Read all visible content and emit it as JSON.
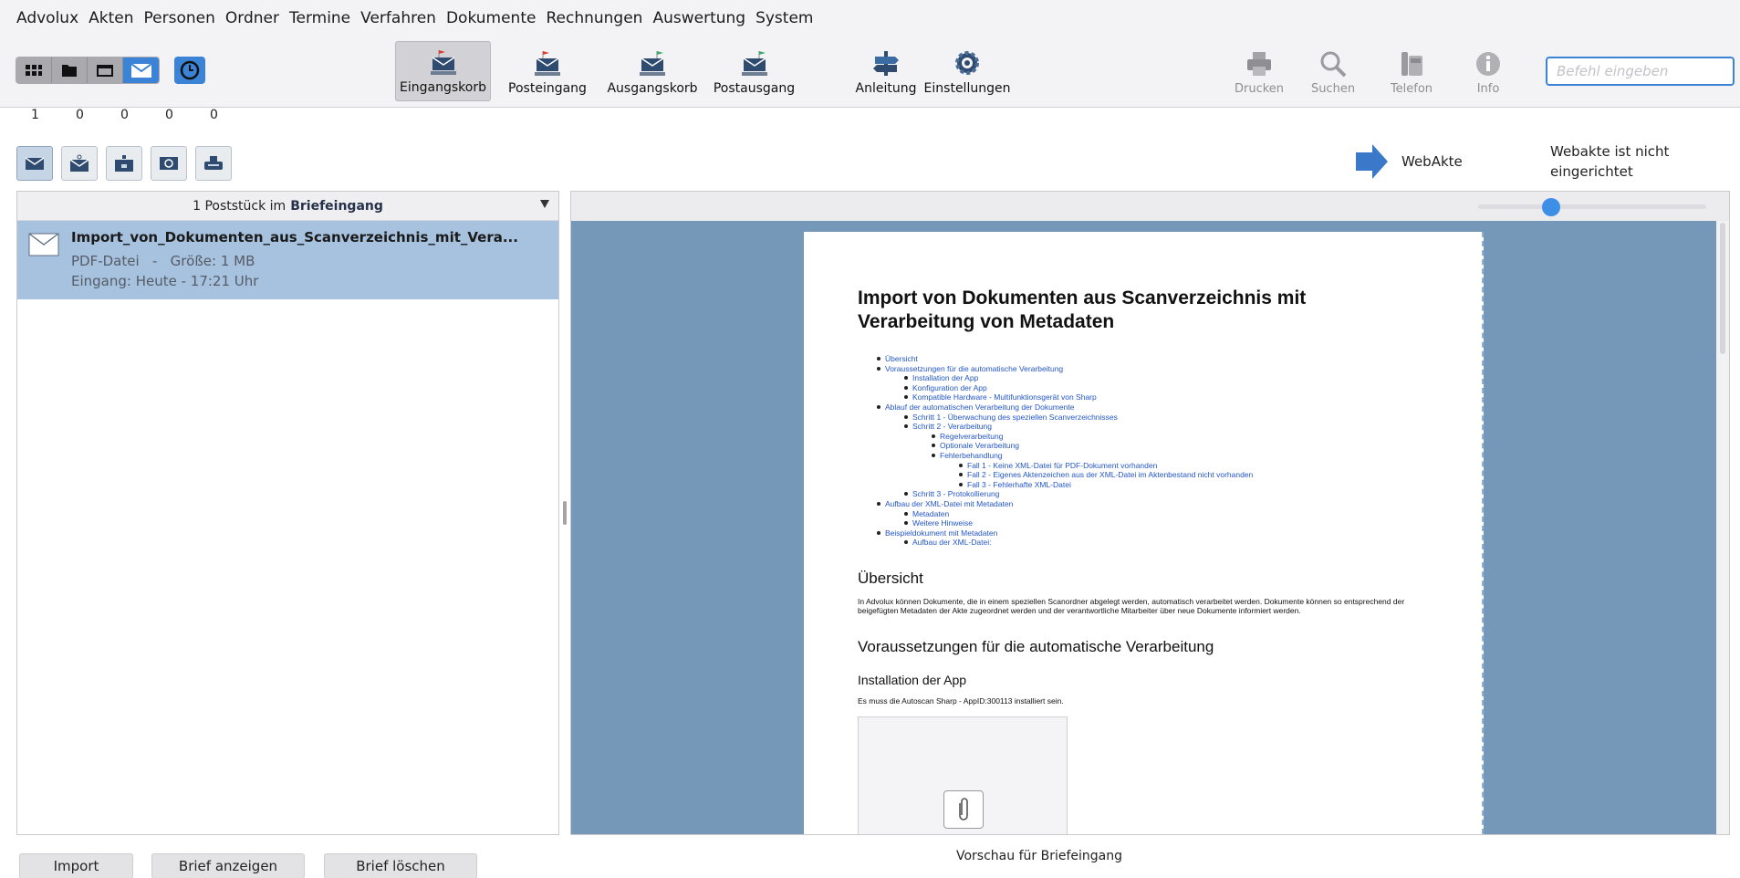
{
  "menu": [
    "Advolux",
    "Akten",
    "Personen",
    "Ordner",
    "Termine",
    "Verfahren",
    "Dokumente",
    "Rechnungen",
    "Auswertung",
    "System"
  ],
  "view_switch": {
    "icons": [
      "grid-icon",
      "folder-icon",
      "window-icon",
      "mail-icon"
    ],
    "active_index": 3,
    "clock_icon": "clock-icon"
  },
  "toolbar": {
    "eingangskorb": "Eingangskorb",
    "posteingang": "Posteingang",
    "ausgangskorb": "Ausgangskorb",
    "postausgang": "Postausgang",
    "anleitung": "Anleitung",
    "einstellungen": "Einstellungen",
    "drucken": "Drucken",
    "suchen": "Suchen",
    "telefon": "Telefon",
    "info": "Info",
    "command_placeholder": "Befehl eingeben",
    "accent": "#3a83d6"
  },
  "counts": [
    "1",
    "0",
    "0",
    "0",
    "0"
  ],
  "webakte": {
    "label": "WebAkte",
    "note": "Webakte ist nicht eingerichtet"
  },
  "list": {
    "header_count": "1 Poststück im",
    "header_box": "Briefeingang",
    "items": [
      {
        "title": "Import_von_Dokumenten_aus_Scanverzeichnis_mit_Vera...",
        "type": "PDF-Datei   -   Größe: 1 MB",
        "received": "Eingang: Heute - 17:21 Uhr"
      }
    ]
  },
  "preview": {
    "zoom_fraction": 0.32,
    "title": "Import von Dokumenten aus Scanverzeichnis mit Verarbeitung von Metadaten",
    "toc": [
      {
        "level": 0,
        "text": "Übersicht"
      },
      {
        "level": 0,
        "text": "Voraussetzungen für die automatische Verarbeitung"
      },
      {
        "level": 1,
        "text": "Installation der App"
      },
      {
        "level": 1,
        "text": "Konfiguration der App"
      },
      {
        "level": 1,
        "text": "Kompatible Hardware - Multifunktionsgerät von Sharp"
      },
      {
        "level": 0,
        "text": "Ablauf der automatischen Verarbeitung der Dokumente"
      },
      {
        "level": 1,
        "text": "Schritt 1 - Überwachung des speziellen Scanverzeichnisses"
      },
      {
        "level": 1,
        "text": "Schritt 2 - Verarbeitung"
      },
      {
        "level": 2,
        "text": "Regelverarbeitung"
      },
      {
        "level": 2,
        "text": "Optionale Verarbeitung"
      },
      {
        "level": 2,
        "text": "Fehlerbehandlung"
      },
      {
        "level": 3,
        "text": "Fall 1 - Keine XML-Datei für PDF-Dokument vorhanden"
      },
      {
        "level": 3,
        "text": "Fall 2 - Eigenes Aktenzeichen aus der XML-Datei im Aktenbestand nicht vorhanden"
      },
      {
        "level": 3,
        "text": "Fall 3 - Fehlerhafte XML-Datei"
      },
      {
        "level": 1,
        "text": "Schritt 3 - Protokollierung"
      },
      {
        "level": 0,
        "text": "Aufbau der XML-Datei mit Metadaten"
      },
      {
        "level": 1,
        "text": "Metadaten"
      },
      {
        "level": 1,
        "text": "Weitere Hinweise"
      },
      {
        "level": 0,
        "text": "Beispieldokument mit Metadaten"
      },
      {
        "level": 1,
        "text": "Aufbau der XML-Datei:"
      }
    ],
    "h_uebersicht": "Übersicht",
    "p_uebersicht": "In Advolux können Dokumente, die in einem speziellen Scanordner abgelegt werden, automatisch verarbeitet werden. Dokumente können so entsprechend der beigefügten Metadaten der Akte zugeordnet werden und der verantwortliche Mitarbeiter über neue Dokumente informiert werden.",
    "h_voraus": "Voraussetzungen für die automatische Verarbeitung",
    "h_install": "Installation der App",
    "p_install": "Es muss die Autoscan Sharp - AppID:300113 installiert sein."
  },
  "bottom": {
    "import": "Import",
    "anzeigen": "Brief anzeigen",
    "loeschen": "Brief löschen",
    "vorschau": "Vorschau für Briefeingang"
  }
}
